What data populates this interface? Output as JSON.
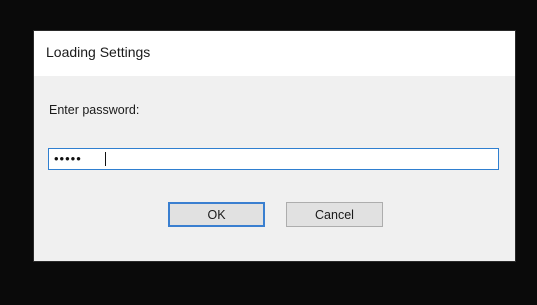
{
  "dialog": {
    "title": "Loading Settings",
    "prompt_label": "Enter password:",
    "password_mask": "•••••",
    "ok_label": "OK",
    "cancel_label": "Cancel"
  }
}
